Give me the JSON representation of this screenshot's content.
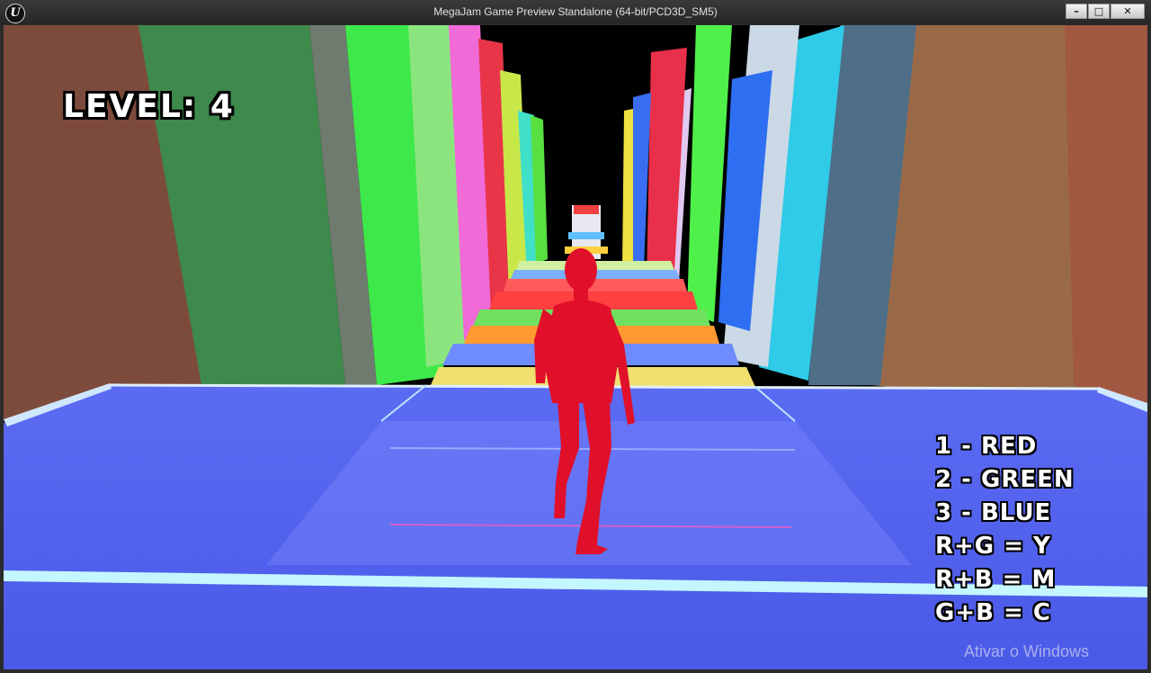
{
  "window": {
    "title": "MegaJam Game Preview Standalone (64-bit/PCD3D_SM5)",
    "logo": "U",
    "controls": {
      "minimize": "–",
      "maximize": "□",
      "close": "✕"
    }
  },
  "hud": {
    "level_text": "LEVEL: 4",
    "legend": [
      "1 - RED",
      "2 - GREEN",
      "3 - BLUE",
      "R+G = Y",
      "R+B = M",
      "G+B = C"
    ]
  },
  "os_overlay": {
    "activation_text": "Ativar o Windows"
  },
  "colors": {
    "floor": "#5a6ff0",
    "character": "#e01030",
    "sky": "#000000"
  }
}
